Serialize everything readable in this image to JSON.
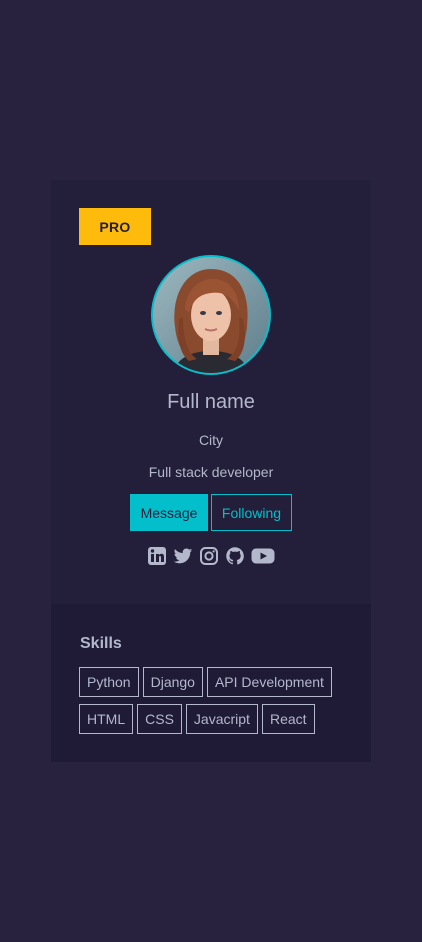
{
  "card": {
    "badge": "PRO",
    "name": "Full name",
    "city": "City",
    "job": "Full stack developer",
    "buttons": {
      "message": "Message",
      "following": "Following"
    },
    "socials": [
      "linkedin-icon",
      "twitter-icon",
      "instagram-icon",
      "github-icon",
      "youtube-icon"
    ]
  },
  "skills": {
    "title": "Skills",
    "items": [
      "Python",
      "Django",
      "API Development",
      "HTML",
      "CSS",
      "Javacript",
      "React"
    ]
  },
  "colors": {
    "background": "#28223f",
    "card": "#231e39",
    "accent": "#03bfcb",
    "badge": "#febb0b",
    "text": "#b3b8cd"
  }
}
